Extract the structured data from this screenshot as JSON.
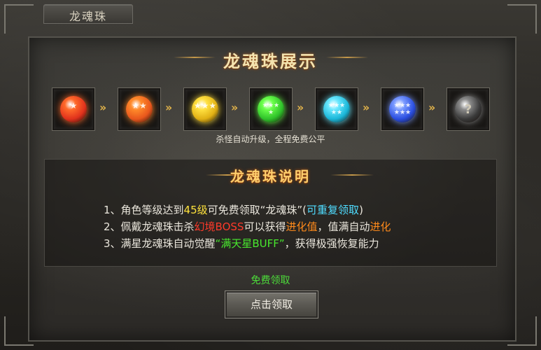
{
  "window": {
    "title": "龙魂珠"
  },
  "showcase": {
    "heading": "龙魂珠展示",
    "balls": [
      {
        "name": "ball-red",
        "color": "#e0321c",
        "glow": "#ff6a2a",
        "stars": 1
      },
      {
        "name": "ball-orange",
        "color": "#e8561c",
        "glow": "#ff8a2a",
        "stars": 2
      },
      {
        "name": "ball-yellow",
        "color": "#e0b014",
        "glow": "#ffe040",
        "stars": 3
      },
      {
        "name": "ball-green",
        "color": "#2fc22a",
        "glow": "#6aff4a",
        "stars": 4
      },
      {
        "name": "ball-cyan",
        "color": "#1ab6d8",
        "glow": "#6ae8ff",
        "stars": 5
      },
      {
        "name": "ball-blue",
        "color": "#2a4ee0",
        "glow": "#7a9aff",
        "stars": 6
      },
      {
        "name": "ball-unknown",
        "color": "#3a3a3a",
        "glow": "#8a8a8a",
        "stars": 0
      }
    ],
    "unknown_symbol": "?",
    "note": "杀怪自动升级，全程免费公平"
  },
  "description": {
    "heading": "龙魂珠说明",
    "line1": {
      "a": "1、角色等级达到",
      "b": "45级",
      "c": "可免费领取“龙魂珠”(",
      "d": "可重复领取",
      "e": ")"
    },
    "line2": {
      "a": "2、佩戴龙魂珠击杀",
      "b": "幻境BOSS",
      "c": "可以获得",
      "d": "进化值",
      "e": "，值满自动",
      "f": "进化"
    },
    "line3": {
      "a": "3、满星龙魂珠自动觉醒",
      "b": "“满天星BUFF”",
      "c": "，获得极强恢复能力"
    }
  },
  "footer": {
    "free_label": "免费领取",
    "claim_button": "点击领取"
  }
}
